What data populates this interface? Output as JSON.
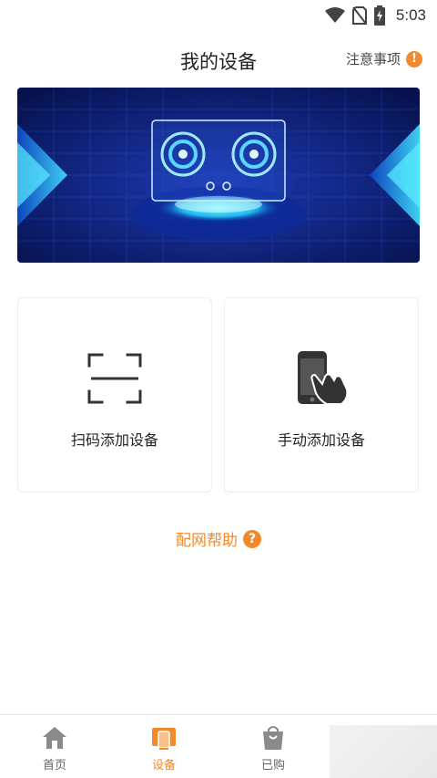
{
  "status_bar": {
    "time": "5:03",
    "icons": [
      "wifi-icon",
      "no-sim-icon",
      "battery-charging-icon"
    ]
  },
  "header": {
    "title": "我的设备",
    "notice_label": "注意事项",
    "notice_badge": "!"
  },
  "banner": {
    "image": "smart-gas-stove-banner"
  },
  "actions": {
    "scan": {
      "label": "扫码添加设备",
      "icon": "scan-frame-icon"
    },
    "manual": {
      "label": "手动添加设备",
      "icon": "phone-touch-icon"
    }
  },
  "help": {
    "label": "配网帮助",
    "icon_text": "?"
  },
  "tabbar": {
    "tabs": [
      {
        "label": "首页",
        "icon": "home-icon",
        "active": false
      },
      {
        "label": "设备",
        "icon": "devices-icon",
        "active": true
      },
      {
        "label": "已购",
        "icon": "shopping-bag-icon",
        "active": false
      }
    ]
  },
  "colors": {
    "accent": "#f08a2c",
    "text": "#222222",
    "banner_dark": "#0a1a6e",
    "banner_glow": "#2fd5ff"
  }
}
